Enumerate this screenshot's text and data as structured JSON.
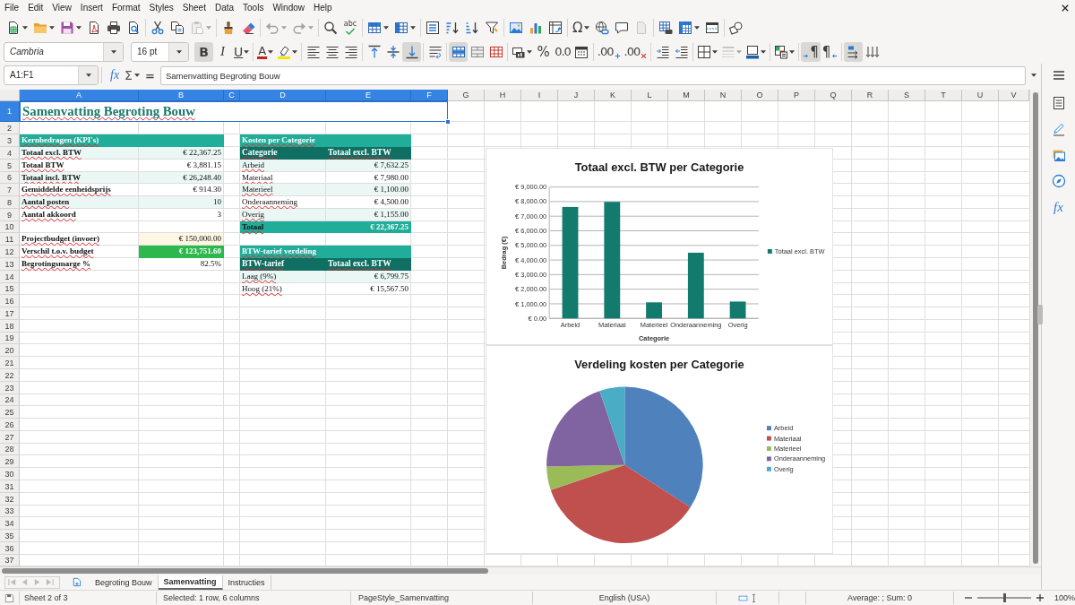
{
  "menu_bar": {
    "items": [
      "File",
      "Edit",
      "View",
      "Insert",
      "Format",
      "Styles",
      "Sheet",
      "Data",
      "Tools",
      "Window",
      "Help"
    ]
  },
  "standard_toolbar": {
    "groups": [
      [
        {
          "kind": "new",
          "dropdown": true,
          "disabled": false
        },
        {
          "kind": "open",
          "dropdown": true,
          "disabled": false
        },
        {
          "kind": "save",
          "dropdown": true,
          "disabled": false
        },
        {
          "kind": "export_pdf",
          "dropdown": false,
          "disabled": false
        },
        {
          "kind": "print",
          "dropdown": false,
          "disabled": false
        },
        {
          "kind": "print_preview",
          "dropdown": false,
          "disabled": false
        }
      ],
      [
        {
          "kind": "cut",
          "dropdown": false,
          "disabled": false
        },
        {
          "kind": "copy",
          "dropdown": false,
          "disabled": false
        },
        {
          "kind": "paste",
          "dropdown": true,
          "disabled": true
        }
      ],
      [
        {
          "kind": "clone",
          "dropdown": false,
          "disabled": false
        },
        {
          "kind": "clear_format",
          "dropdown": false,
          "disabled": false
        }
      ],
      [
        {
          "kind": "undo",
          "dropdown": true,
          "disabled": true
        },
        {
          "kind": "redo",
          "dropdown": true,
          "disabled": true
        }
      ],
      [
        {
          "kind": "find_replace",
          "dropdown": false,
          "disabled": false
        },
        {
          "kind": "spelling",
          "glyph": "abc",
          "dropdown": false,
          "disabled": false
        }
      ],
      [
        {
          "kind": "rows",
          "dropdown": true,
          "disabled": false
        },
        {
          "kind": "columns",
          "dropdown": true,
          "disabled": false
        }
      ],
      [
        {
          "kind": "sort",
          "dropdown": false,
          "disabled": false
        },
        {
          "kind": "sort_ascending",
          "dropdown": false,
          "disabled": false
        },
        {
          "kind": "sort_descending",
          "dropdown": false,
          "disabled": false
        },
        {
          "kind": "autofilter",
          "dropdown": false,
          "disabled": false
        }
      ],
      [
        {
          "kind": "image",
          "dropdown": false,
          "disabled": false
        },
        {
          "kind": "chart",
          "dropdown": false,
          "disabled": false
        },
        {
          "kind": "pivot_table",
          "dropdown": false,
          "disabled": false
        }
      ],
      [
        {
          "kind": "special_character",
          "glyph": "Ω",
          "dropdown": true,
          "disabled": false
        },
        {
          "kind": "hyperlink",
          "dropdown": false,
          "disabled": false
        },
        {
          "kind": "comment",
          "dropdown": false,
          "disabled": false
        },
        {
          "kind": "header_footer",
          "dropdown": false,
          "disabled": true
        }
      ],
      [
        {
          "kind": "print_area",
          "dropdown": false,
          "disabled": false
        },
        {
          "kind": "freeze",
          "dropdown": true,
          "disabled": false
        },
        {
          "kind": "split_window",
          "dropdown": false,
          "disabled": false
        }
      ],
      [
        {
          "kind": "shapes",
          "dropdown": false,
          "disabled": false
        }
      ]
    ]
  },
  "formatting_toolbar": {
    "font_name": "Cambria",
    "font_size": "16 pt",
    "groups": [
      [
        {
          "kind": "bold",
          "glyph": "B",
          "selected": true,
          "disabled": false,
          "dropdown": false
        },
        {
          "kind": "italic",
          "glyph": "I",
          "selected": false,
          "disabled": false,
          "dropdown": false
        },
        {
          "kind": "underline",
          "glyph": "U",
          "selected": false,
          "disabled": false,
          "dropdown": true
        }
      ],
      [
        {
          "kind": "font_color",
          "glyph": "A",
          "selected": false,
          "disabled": false,
          "dropdown": true
        },
        {
          "kind": "highlight",
          "selected": false,
          "disabled": false,
          "dropdown": true
        }
      ],
      [
        {
          "kind": "align_left",
          "selected": false,
          "disabled": false,
          "dropdown": false
        },
        {
          "kind": "align_center",
          "selected": false,
          "disabled": false,
          "dropdown": false
        },
        {
          "kind": "align_right",
          "selected": false,
          "disabled": false,
          "dropdown": false
        }
      ],
      [
        {
          "kind": "align_top",
          "selected": false,
          "disabled": false,
          "dropdown": false
        },
        {
          "kind": "align_middle",
          "selected": false,
          "disabled": false,
          "dropdown": false
        },
        {
          "kind": "align_bottom",
          "selected": true,
          "disabled": false,
          "dropdown": false
        }
      ],
      [
        {
          "kind": "wrap_text",
          "selected": false,
          "disabled": false,
          "dropdown": false
        }
      ],
      [
        {
          "kind": "merge_center",
          "selected": true,
          "disabled": false,
          "dropdown": false
        },
        {
          "kind": "merge_cells",
          "selected": false,
          "disabled": false,
          "dropdown": false
        },
        {
          "kind": "unmerge_cells",
          "selected": false,
          "disabled": false,
          "dropdown": false
        }
      ],
      [
        {
          "kind": "currency",
          "selected": false,
          "disabled": false,
          "dropdown": true
        },
        {
          "kind": "percent",
          "glyph": "%",
          "selected": false,
          "disabled": false,
          "dropdown": false
        },
        {
          "kind": "number",
          "glyph": "0.0",
          "selected": false,
          "disabled": false,
          "dropdown": false
        },
        {
          "kind": "date",
          "selected": false,
          "disabled": false,
          "dropdown": false
        }
      ],
      [
        {
          "kind": "add_decimal",
          "glyph": ".00",
          "selected": false,
          "disabled": false,
          "dropdown": false
        },
        {
          "kind": "remove_decimal",
          "glyph": ".00",
          "selected": false,
          "disabled": false,
          "dropdown": false
        }
      ],
      [
        {
          "kind": "indent_increase",
          "selected": false,
          "disabled": false,
          "dropdown": false
        },
        {
          "kind": "indent_decrease",
          "selected": false,
          "disabled": false,
          "dropdown": false
        }
      ],
      [
        {
          "kind": "borders",
          "selected": false,
          "disabled": false,
          "dropdown": true
        },
        {
          "kind": "border_style",
          "selected": false,
          "disabled": true,
          "dropdown": true
        },
        {
          "kind": "border_color",
          "selected": false,
          "disabled": false,
          "dropdown": true
        }
      ],
      [
        {
          "kind": "conditional",
          "selected": false,
          "disabled": false,
          "dropdown": true
        }
      ],
      [
        {
          "kind": "ltr",
          "glyph": "¶",
          "selected": true,
          "disabled": false,
          "dropdown": false
        },
        {
          "kind": "rtl",
          "glyph": "¶",
          "selected": false,
          "disabled": false,
          "dropdown": false
        }
      ],
      [
        {
          "kind": "text_horizontal",
          "selected": true,
          "disabled": false,
          "dropdown": false
        },
        {
          "kind": "text_vertical",
          "selected": false,
          "disabled": false,
          "dropdown": false
        }
      ]
    ]
  },
  "formula_bar": {
    "name_box": "A1:F1",
    "function_wizard": "fx",
    "sum": "Σ",
    "equals": "=",
    "content": "Samenvatting Begroting Bouw"
  },
  "sheet": {
    "auto_spellcheck": true,
    "columns": [
      {
        "label": "A",
        "selected": true
      },
      {
        "label": "B",
        "selected": true
      },
      {
        "label": "C",
        "selected": true
      },
      {
        "label": "D",
        "selected": true
      },
      {
        "label": "E",
        "selected": true
      },
      {
        "label": "F",
        "selected": true
      },
      {
        "label": "G",
        "selected": false
      },
      {
        "label": "H",
        "selected": false
      },
      {
        "label": "I",
        "selected": false
      },
      {
        "label": "J",
        "selected": false
      },
      {
        "label": "K",
        "selected": false
      },
      {
        "label": "L",
        "selected": false
      },
      {
        "label": "M",
        "selected": false
      },
      {
        "label": "N",
        "selected": false
      },
      {
        "label": "O",
        "selected": false
      },
      {
        "label": "P",
        "selected": false
      },
      {
        "label": "Q",
        "selected": false
      },
      {
        "label": "R",
        "selected": false
      },
      {
        "label": "S",
        "selected": false
      },
      {
        "label": "T",
        "selected": false
      },
      {
        "label": "U",
        "selected": false
      },
      {
        "label": "V",
        "selected": false
      }
    ],
    "rows": [
      {
        "label": "1",
        "selected": true
      },
      {
        "label": "2",
        "selected": false
      },
      {
        "label": "3",
        "selected": false
      },
      {
        "label": "4",
        "selected": false
      },
      {
        "label": "5",
        "selected": false
      },
      {
        "label": "6",
        "selected": false
      },
      {
        "label": "7",
        "selected": false
      },
      {
        "label": "8",
        "selected": false
      },
      {
        "label": "9",
        "selected": false
      },
      {
        "label": "10",
        "selected": false
      },
      {
        "label": "11",
        "selected": false
      },
      {
        "label": "12",
        "selected": false
      },
      {
        "label": "13",
        "selected": false
      },
      {
        "label": "14",
        "selected": false
      },
      {
        "label": "15",
        "selected": false
      },
      {
        "label": "16",
        "selected": false
      },
      {
        "label": "17",
        "selected": false
      },
      {
        "label": "18",
        "selected": false
      },
      {
        "label": "19",
        "selected": false
      },
      {
        "label": "20",
        "selected": false
      },
      {
        "label": "21",
        "selected": false
      },
      {
        "label": "22",
        "selected": false
      },
      {
        "label": "23",
        "selected": false
      },
      {
        "label": "24",
        "selected": false
      },
      {
        "label": "25",
        "selected": false
      },
      {
        "label": "26",
        "selected": false
      },
      {
        "label": "27",
        "selected": false
      },
      {
        "label": "28",
        "selected": false
      },
      {
        "label": "29",
        "selected": false
      },
      {
        "label": "30",
        "selected": false
      },
      {
        "label": "31",
        "selected": false
      },
      {
        "label": "32",
        "selected": false
      },
      {
        "label": "33",
        "selected": false
      },
      {
        "label": "34",
        "selected": false
      },
      {
        "label": "35",
        "selected": false
      },
      {
        "label": "36",
        "selected": false
      },
      {
        "label": "37",
        "selected": false
      }
    ],
    "title": {
      "text": "Samenvatting Begroting Bouw",
      "selected": true
    },
    "kpi_table": {
      "heading": "Kernbedragen (KPI's)",
      "rows": [
        {
          "label": "Totaal excl. BTW",
          "value": "€ 22,367.25"
        },
        {
          "label": "Totaal BTW",
          "value": "€ 3,881.15"
        },
        {
          "label": "Totaal incl. BTW",
          "value": "€ 26,248.40"
        },
        {
          "label": "Gemiddelde eenheidsprijs",
          "value": "€ 914.30"
        },
        {
          "label": "Aantal posten",
          "value": "10"
        },
        {
          "label": "Aantal akkoord",
          "value": "3"
        }
      ]
    },
    "budget_rows": [
      {
        "kind": "input",
        "label": "Projectbudget (invoer)",
        "value": "€ 150,000.00"
      },
      {
        "kind": "positive",
        "label": "Verschil t.o.v. budget",
        "value": "€ 123,751.60"
      },
      {
        "kind": "plain",
        "label": "Begrotingsmarge %",
        "value": "82.5%"
      }
    ],
    "cost_table": {
      "heading": "Kosten per Categorie",
      "columns": [
        "Categorie",
        "Totaal excl. BTW"
      ],
      "rows": [
        {
          "label": "Arbeid",
          "value": "€ 7,632.25"
        },
        {
          "label": "Materiaal",
          "value": "€ 7,980.00"
        },
        {
          "label": "Materieel",
          "value": "€ 1,100.00"
        },
        {
          "label": "Onderaanneming",
          "value": "€ 4,500.00"
        },
        {
          "label": "Overig",
          "value": "€ 1,155.00"
        }
      ],
      "total": {
        "label": "Totaal",
        "value": "€ 22,367.25"
      }
    },
    "vat_table": {
      "heading": "BTW-tarief verdeling",
      "columns": [
        "BTW-tarief",
        "Totaal excl. BTW"
      ],
      "rows": [
        {
          "label": "Laag (9%)",
          "value": "€ 6,799.75"
        },
        {
          "label": "Hoog (21%)",
          "value": "€ 15,567.50"
        }
      ]
    },
    "charts": [
      {
        "chart_data": {
          "type": "bar",
          "title": "Totaal excl. BTW per Categorie",
          "xlabel": "Categorie",
          "ylabel": "Bedrag (€)",
          "categories": [
            "Arbeid",
            "Materiaal",
            "Materieel",
            "Onderaanneming",
            "Overig"
          ],
          "series": [
            {
              "name": "Totaal excl. BTW",
              "color": "#137a6e",
              "values": [
                7632.25,
                7980,
                1100,
                4500,
                1155
              ]
            }
          ],
          "ylim": [
            0,
            9000
          ],
          "yticks": [
            {
              "value": 0,
              "label": "€ 0.00"
            },
            {
              "value": 1000,
              "label": "€ 1,000.00"
            },
            {
              "value": 2000,
              "label": "€ 2,000.00"
            },
            {
              "value": 3000,
              "label": "€ 3,000.00"
            },
            {
              "value": 4000,
              "label": "€ 4,000.00"
            },
            {
              "value": 5000,
              "label": "€ 5,000.00"
            },
            {
              "value": 6000,
              "label": "€ 6,000.00"
            },
            {
              "value": 7000,
              "label": "€ 7,000.00"
            },
            {
              "value": 8000,
              "label": "€ 8,000.00"
            },
            {
              "value": 9000,
              "label": "€ 9,000.00"
            }
          ],
          "grid": true,
          "legend": true
        }
      },
      {
        "chart_data": {
          "type": "pie",
          "title": "Verdeling kosten per Categorie",
          "categories": [
            "Arbeid",
            "Materiaal",
            "Materieel",
            "Onderaanneming",
            "Overig"
          ],
          "values": [
            34.1,
            35.7,
            4.9,
            20.1,
            5.2
          ],
          "colors": [
            "#4f81bd",
            "#c0504d",
            "#9bbb59",
            "#8064a2",
            "#4bacc6"
          ],
          "legend": true
        }
      }
    ]
  },
  "sheet_tabs": {
    "scroll_buttons": [
      {
        "kind": "first",
        "disabled": true
      },
      {
        "kind": "previous",
        "disabled": true
      },
      {
        "kind": "next",
        "disabled": true
      },
      {
        "kind": "last",
        "disabled": true
      }
    ],
    "tabs": [
      {
        "label": "Begroting Bouw",
        "selected": false
      },
      {
        "label": "Samenvatting",
        "selected": true
      },
      {
        "label": "Instructies",
        "selected": false
      }
    ]
  },
  "sidebar": {
    "tabs": [
      {
        "kind": "menu"
      },
      {
        "kind": "properties"
      },
      {
        "kind": "styles"
      },
      {
        "kind": "gallery"
      },
      {
        "kind": "navigator"
      },
      {
        "kind": "functions",
        "glyph": "fx"
      }
    ]
  },
  "status_bar": {
    "sheet_position": "Sheet 2 of 3",
    "selection": "Selected: 1 row, 6 columns",
    "page_style": "PageStyle_Samenvatting",
    "language": "English (USA)",
    "statistics": "Average: ; Sum: 0",
    "zoom": {
      "level": 0.5,
      "reading": "100%"
    }
  }
}
